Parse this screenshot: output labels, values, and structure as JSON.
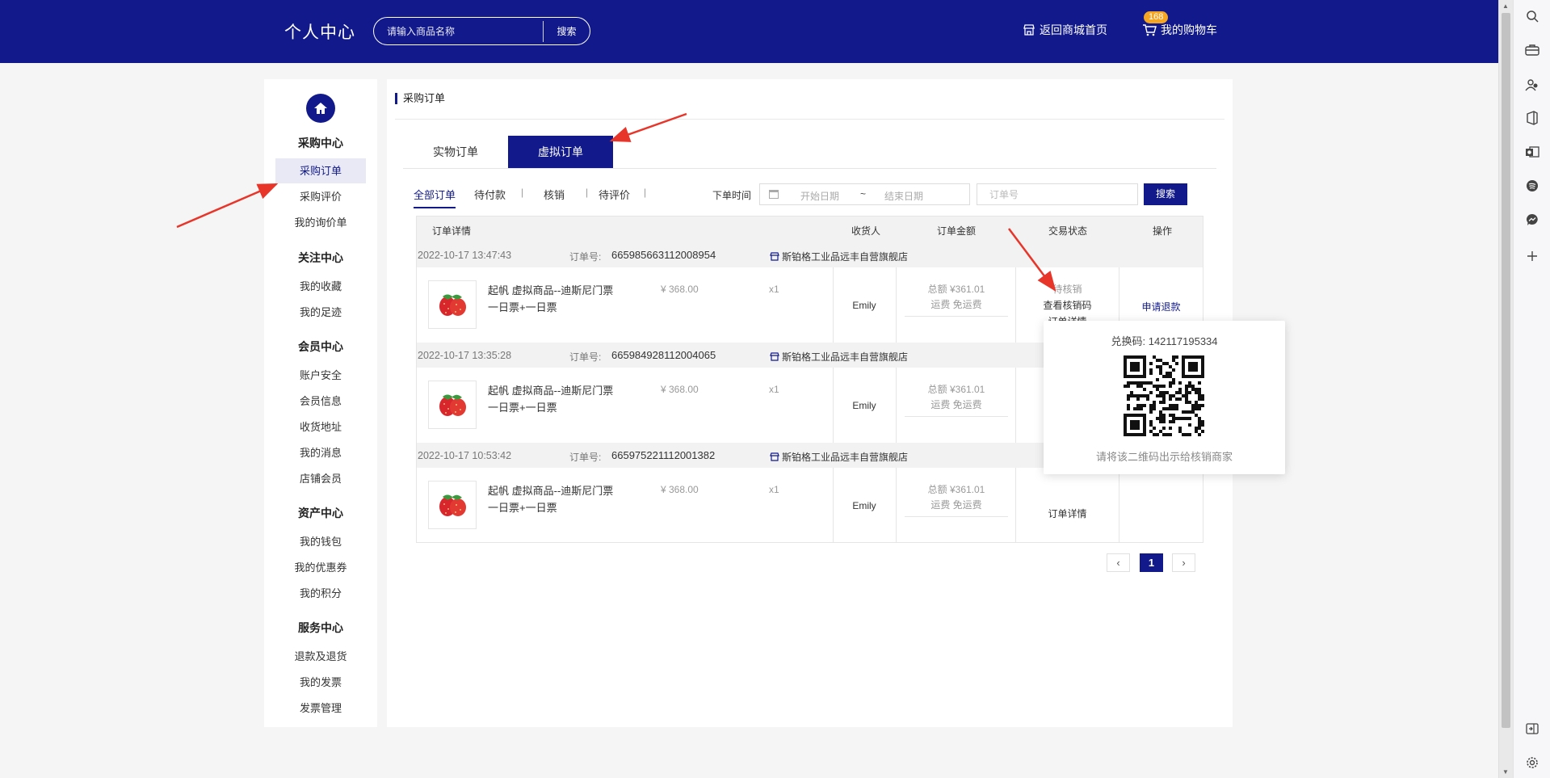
{
  "header": {
    "brand": "个人中心",
    "search_placeholder": "请输入商品名称",
    "search_button": "搜索",
    "home_link": "返回商城首页",
    "cart_link": "我的购物车",
    "cart_count": "168"
  },
  "sidebar": {
    "sections": [
      {
        "title": "采购中心",
        "items": [
          "采购订单",
          "采购评价",
          "我的询价单"
        ]
      },
      {
        "title": "关注中心",
        "items": [
          "我的收藏",
          "我的足迹"
        ]
      },
      {
        "title": "会员中心",
        "items": [
          "账户安全",
          "会员信息",
          "收货地址",
          "我的消息",
          "店铺会员"
        ]
      },
      {
        "title": "资产中心",
        "items": [
          "我的钱包",
          "我的优惠券",
          "我的积分"
        ]
      },
      {
        "title": "服务中心",
        "items": [
          "退款及退货",
          "我的发票",
          "发票管理"
        ]
      }
    ],
    "active_item": "采购订单"
  },
  "main": {
    "title": "采购订单",
    "tabs": [
      "实物订单",
      "虚拟订单"
    ],
    "active_tab": "虚拟订单",
    "filters": [
      "全部订单",
      "待付款",
      "核销",
      "待评价"
    ],
    "active_filter": "全部订单",
    "time_label": "下单时间",
    "date_start_placeholder": "开始日期",
    "date_separator": "~",
    "date_end_placeholder": "结束日期",
    "order_no_placeholder": "订单号",
    "search_button": "搜索"
  },
  "table": {
    "headers": [
      "订单详情",
      "收货人",
      "订单金额",
      "交易状态",
      "操作"
    ],
    "order_no_label": "订单号:",
    "orders": [
      {
        "time": "2022-10-17 13:47:43",
        "order_no": "665985663112008954",
        "shop": "斯铂格工业品远丰自营旗舰店",
        "product_name": "起帆 虚拟商品--迪斯尼门票 一日票+一日票",
        "price": "¥ 368.00",
        "qty": "x1",
        "receiver": "Emily",
        "total": "总额 ¥361.01",
        "shipping": "运费 免运费",
        "status": [
          "待核销",
          "查看核销码",
          "订单详情"
        ],
        "operation": "申请退款"
      },
      {
        "time": "2022-10-17 13:35:28",
        "order_no": "665984928112004065",
        "shop": "斯铂格工业品远丰自营旗舰店",
        "product_name": "起帆 虚拟商品--迪斯尼门票 一日票+一日票",
        "price": "¥ 368.00",
        "qty": "x1",
        "receiver": "Emily",
        "total": "总额 ¥361.01",
        "shipping": "运费 免运费",
        "status": [],
        "operation": ""
      },
      {
        "time": "2022-10-17 10:53:42",
        "order_no": "665975221112001382",
        "shop": "斯铂格工业品远丰自营旗舰店",
        "product_name": "起帆 虚拟商品--迪斯尼门票 一日票+一日票",
        "price": "¥ 368.00",
        "qty": "x1",
        "receiver": "Emily",
        "total": "总额 ¥361.01",
        "shipping": "运费 免运费",
        "status": [
          "订单详情"
        ],
        "operation": ""
      }
    ]
  },
  "pagination": {
    "prev": "‹",
    "current": "1",
    "next": "›"
  },
  "popup": {
    "code_label": "兑换码:",
    "code": "142117195334",
    "hint": "请将该二维码出示给核销商家"
  },
  "rail_icons": [
    "search-icon",
    "briefcase-icon",
    "people-icon",
    "office-icon",
    "outlook-icon",
    "spotify-icon",
    "messenger-icon",
    "plus-icon",
    "sidebar-toggle-icon",
    "settings-icon"
  ],
  "colors": {
    "brand": "#121a8b",
    "accent": "#f5a623",
    "arrow": "#e8352a"
  }
}
